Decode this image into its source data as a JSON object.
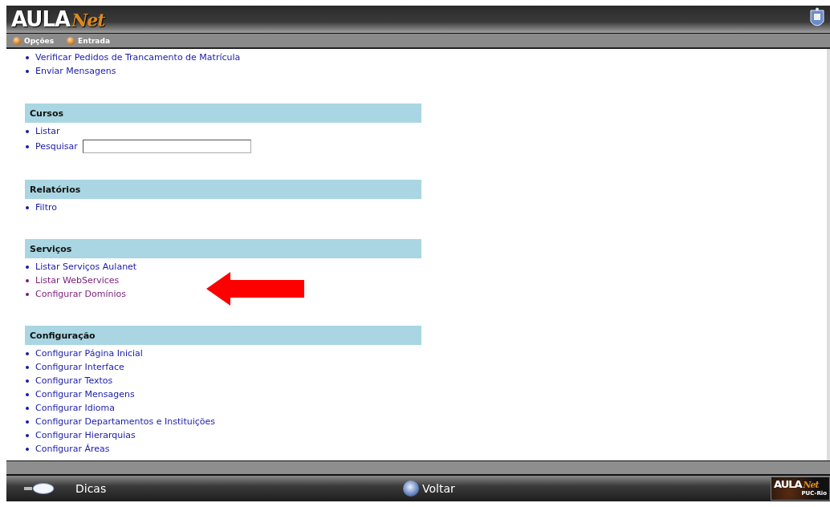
{
  "header": {
    "logo": {
      "main": "AULA",
      "script": "Net"
    }
  },
  "menu": [
    {
      "label": "Opções"
    },
    {
      "label": "Entrada"
    }
  ],
  "intro_links": [
    {
      "label": "Verificar Pedidos de Trancamento de Matrícula",
      "visited": false
    },
    {
      "label": "Enviar Mensagens",
      "visited": false
    }
  ],
  "sections": [
    {
      "title": "Cursos",
      "items": [
        {
          "kind": "link",
          "label": "Listar",
          "visited": false
        },
        {
          "kind": "search",
          "label": "Pesquisar",
          "visited": false
        }
      ]
    },
    {
      "title": "Relatórios",
      "items": [
        {
          "kind": "link",
          "label": "Filtro",
          "visited": false
        }
      ]
    },
    {
      "title": "Serviços",
      "items": [
        {
          "kind": "link",
          "label": "Listar Serviços Aulanet",
          "visited": false
        },
        {
          "kind": "link",
          "label": "Listar WebServices",
          "visited": true
        },
        {
          "kind": "link",
          "label": "Configurar Domínios",
          "visited": true
        }
      ]
    },
    {
      "title": "Configuração",
      "items": [
        {
          "kind": "link",
          "label": "Configurar Página Inicial",
          "visited": false
        },
        {
          "kind": "link",
          "label": "Configurar Interface",
          "visited": false
        },
        {
          "kind": "link",
          "label": "Configurar Textos",
          "visited": false
        },
        {
          "kind": "link",
          "label": "Configurar Mensagens",
          "visited": false
        },
        {
          "kind": "link",
          "label": "Configurar Idioma",
          "visited": false
        },
        {
          "kind": "link",
          "label": "Configurar Departamentos e Instituições",
          "visited": false
        },
        {
          "kind": "link",
          "label": "Configurar Hierarquias",
          "visited": false
        },
        {
          "kind": "link",
          "label": "Configurar Áreas",
          "visited": false
        }
      ]
    }
  ],
  "footer": {
    "tips": "Dicas",
    "back": "Voltar",
    "badge": {
      "main": "AULA",
      "script": "Net",
      "caption": "PUC-Rio"
    }
  }
}
